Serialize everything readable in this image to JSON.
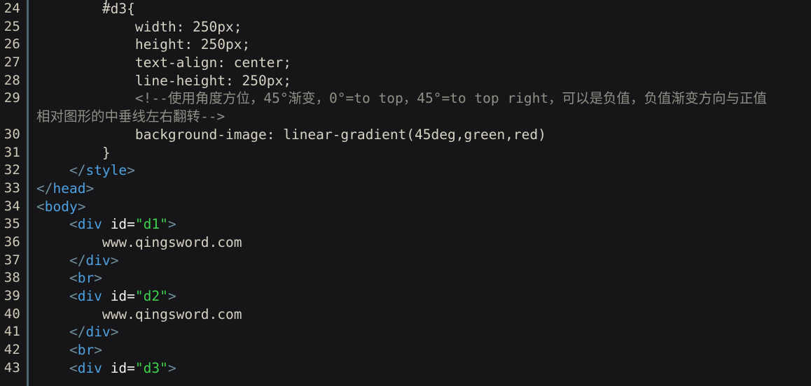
{
  "editor": {
    "theme_background": "#161618",
    "gutter_rule_color": "#4d6670",
    "line_number_color": "#cfc9b7",
    "clipped_top_line": "        }",
    "colors": {
      "plain_text": "#d6d2c4",
      "tag_name": "#4ea1e0",
      "tag_punctuation": "#6f8f9e",
      "attribute_name": "#f2f2f2",
      "attribute_value": "#3fd14b",
      "comment": "#8f8f86"
    },
    "lines": [
      {
        "number": "24",
        "tokens": [
          {
            "kind": "plain",
            "text": "        #d3{"
          }
        ]
      },
      {
        "number": "25",
        "tokens": [
          {
            "kind": "plain",
            "text": "            width: 250px;"
          }
        ]
      },
      {
        "number": "26",
        "tokens": [
          {
            "kind": "plain",
            "text": "            height: 250px;"
          }
        ]
      },
      {
        "number": "27",
        "tokens": [
          {
            "kind": "plain",
            "text": "            text-align: center;"
          }
        ]
      },
      {
        "number": "28",
        "tokens": [
          {
            "kind": "plain",
            "text": "            line-height: 250px;"
          }
        ]
      },
      {
        "number": "29",
        "tokens": [
          {
            "kind": "comment",
            "text": "            <!--使用角度方位，45°渐变，0°=to top，45°=to top right，可以是负值，负值渐变方向与正值"
          }
        ]
      },
      {
        "number": "",
        "wrapped": true,
        "tokens": [
          {
            "kind": "comment",
            "text": "相对图形的中垂线左右翻转-->"
          }
        ]
      },
      {
        "number": "30",
        "tokens": [
          {
            "kind": "plain",
            "text": "            background-image: linear-gradient(45deg,green,red)"
          }
        ]
      },
      {
        "number": "31",
        "tokens": [
          {
            "kind": "plain",
            "text": "        }"
          }
        ]
      },
      {
        "number": "32",
        "tokens": [
          {
            "kind": "punct",
            "text": "    </"
          },
          {
            "kind": "tag",
            "text": "style"
          },
          {
            "kind": "punct",
            "text": ">"
          }
        ]
      },
      {
        "number": "33",
        "tokens": [
          {
            "kind": "punct",
            "text": "</"
          },
          {
            "kind": "tag",
            "text": "head"
          },
          {
            "kind": "punct",
            "text": ">"
          }
        ]
      },
      {
        "number": "34",
        "tokens": [
          {
            "kind": "punct",
            "text": "<"
          },
          {
            "kind": "tag",
            "text": "body"
          },
          {
            "kind": "punct",
            "text": ">"
          }
        ]
      },
      {
        "number": "35",
        "tokens": [
          {
            "kind": "punct",
            "text": "    <"
          },
          {
            "kind": "tag",
            "text": "div"
          },
          {
            "kind": "plain",
            "text": " "
          },
          {
            "kind": "attr",
            "text": "id"
          },
          {
            "kind": "eq",
            "text": "="
          },
          {
            "kind": "string",
            "text": "\"d1\""
          },
          {
            "kind": "punct",
            "text": ">"
          }
        ]
      },
      {
        "number": "36",
        "tokens": [
          {
            "kind": "text",
            "text": "        www.qingsword.com"
          }
        ]
      },
      {
        "number": "37",
        "tokens": [
          {
            "kind": "punct",
            "text": "    </"
          },
          {
            "kind": "tag",
            "text": "div"
          },
          {
            "kind": "punct",
            "text": ">"
          }
        ]
      },
      {
        "number": "38",
        "tokens": [
          {
            "kind": "punct",
            "text": "    <"
          },
          {
            "kind": "tag",
            "text": "br"
          },
          {
            "kind": "punct",
            "text": ">"
          }
        ]
      },
      {
        "number": "39",
        "tokens": [
          {
            "kind": "punct",
            "text": "    <"
          },
          {
            "kind": "tag",
            "text": "div"
          },
          {
            "kind": "plain",
            "text": " "
          },
          {
            "kind": "attr",
            "text": "id"
          },
          {
            "kind": "eq",
            "text": "="
          },
          {
            "kind": "string",
            "text": "\"d2\""
          },
          {
            "kind": "punct",
            "text": ">"
          }
        ]
      },
      {
        "number": "40",
        "tokens": [
          {
            "kind": "text",
            "text": "        www.qingsword.com"
          }
        ]
      },
      {
        "number": "41",
        "tokens": [
          {
            "kind": "punct",
            "text": "    </"
          },
          {
            "kind": "tag",
            "text": "div"
          },
          {
            "kind": "punct",
            "text": ">"
          }
        ]
      },
      {
        "number": "42",
        "tokens": [
          {
            "kind": "punct",
            "text": "    <"
          },
          {
            "kind": "tag",
            "text": "br"
          },
          {
            "kind": "punct",
            "text": ">"
          }
        ]
      },
      {
        "number": "43",
        "tokens": [
          {
            "kind": "punct",
            "text": "    <"
          },
          {
            "kind": "tag",
            "text": "div"
          },
          {
            "kind": "plain",
            "text": " "
          },
          {
            "kind": "attr",
            "text": "id"
          },
          {
            "kind": "eq",
            "text": "="
          },
          {
            "kind": "string",
            "text": "\"d3\""
          },
          {
            "kind": "punct",
            "text": ">"
          }
        ]
      }
    ]
  }
}
